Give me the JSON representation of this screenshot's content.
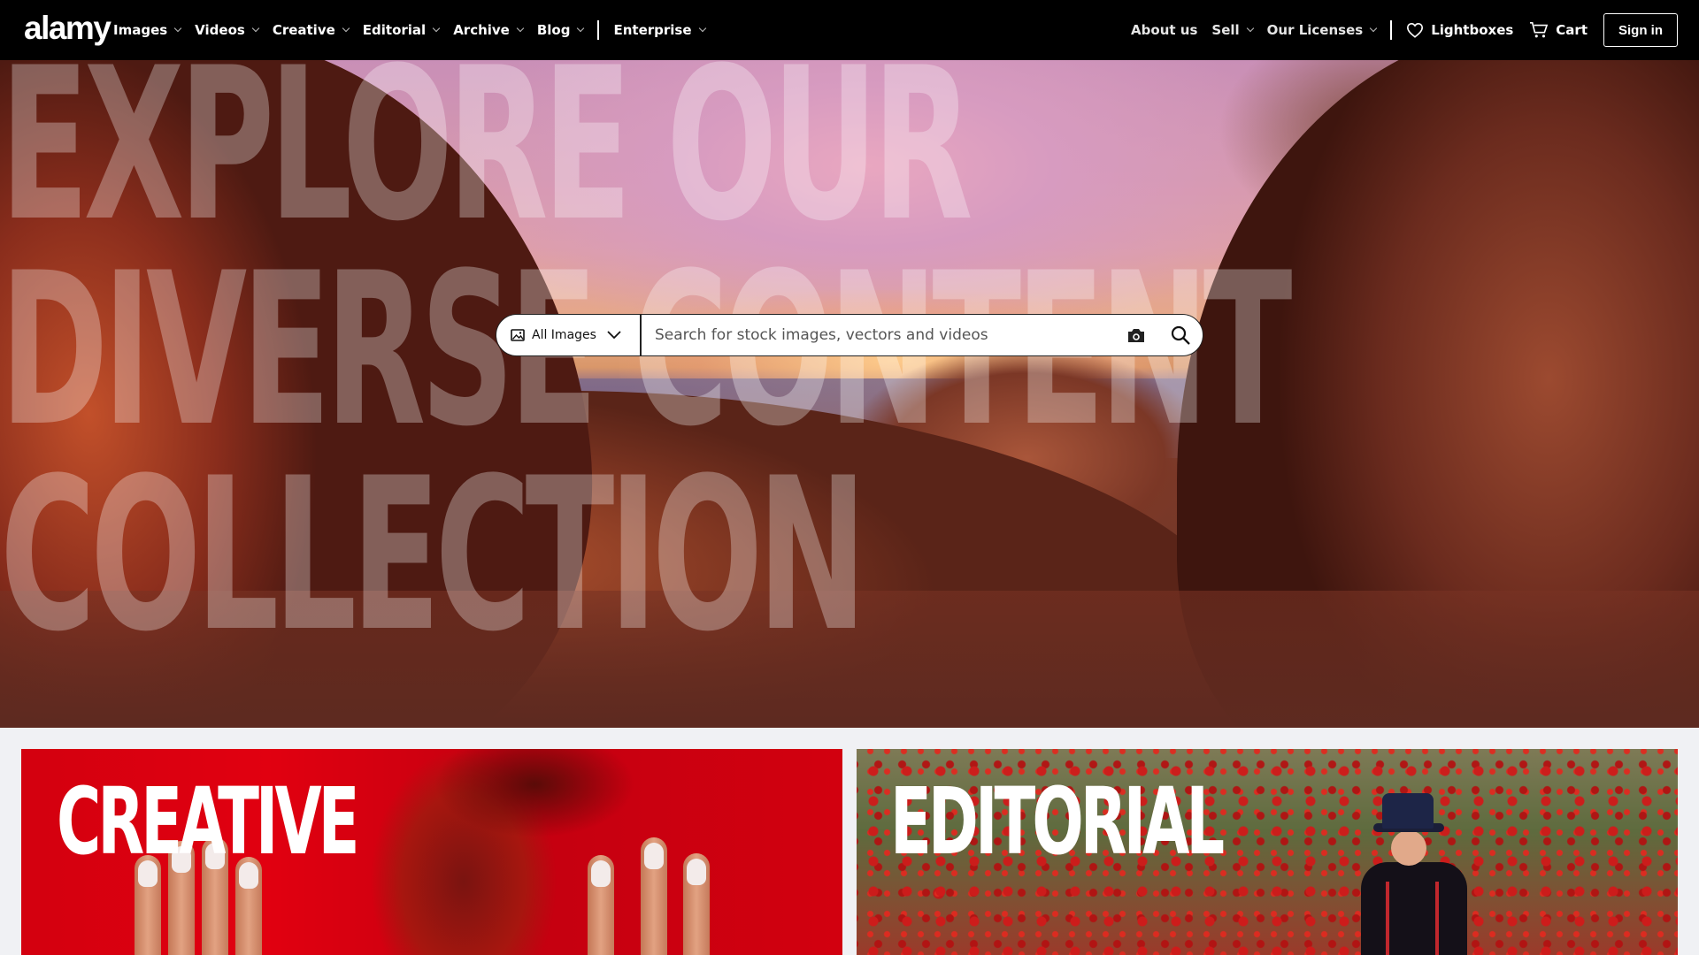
{
  "brand": {
    "logo": "alamy"
  },
  "nav": {
    "left": [
      {
        "label": "Images"
      },
      {
        "label": "Videos"
      },
      {
        "label": "Creative"
      },
      {
        "label": "Editorial"
      },
      {
        "label": "Archive"
      },
      {
        "label": "Blog"
      }
    ],
    "enterprise": "Enterprise",
    "right": {
      "about": "About us",
      "sell": "Sell",
      "licenses": "Our Licenses",
      "lightboxes": "Lightboxes",
      "cart": "Cart",
      "signin": "Sign in"
    }
  },
  "hero": {
    "headline_lines": [
      "EXPLORE OUR",
      "DIVERSE CONTENT",
      "COLLECTION"
    ],
    "search": {
      "type_label": "All Images",
      "placeholder": "Search for stock images, vectors and videos",
      "value": ""
    }
  },
  "cards": {
    "creative": {
      "title": "CREATIVE"
    },
    "editorial": {
      "title": "EDITORIAL"
    }
  },
  "colors": {
    "nav_bg": "#000000",
    "creative_red": "#d3000f",
    "page_bg": "#f0f1f4"
  }
}
